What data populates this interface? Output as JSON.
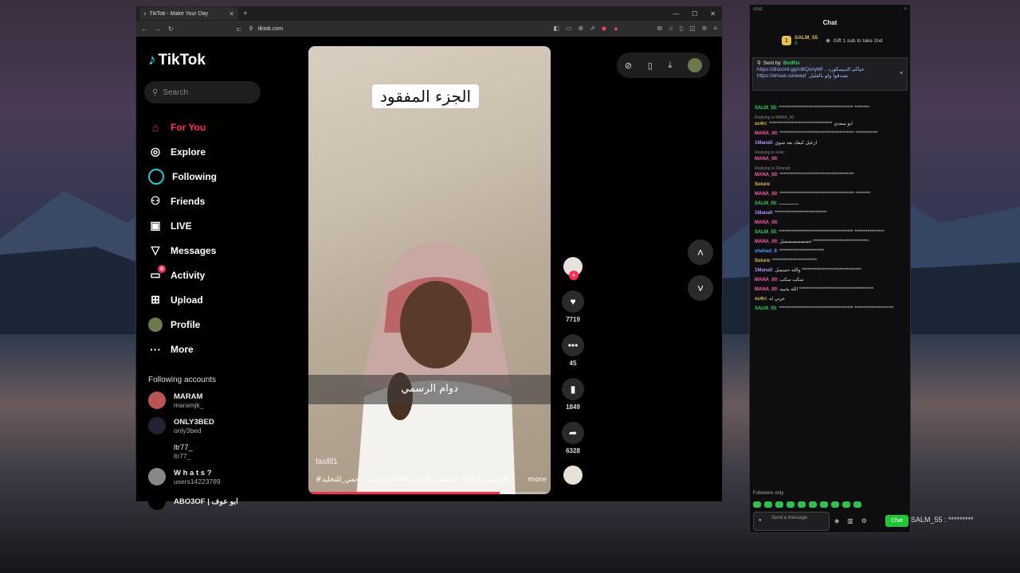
{
  "colors": {
    "tiktok_red": "#fe2c55",
    "chat_green": "#1fc734",
    "bg_dark": "#000000"
  },
  "browser": {
    "tab_title": "TikTok - Make Your Day",
    "url": "tiktok.com"
  },
  "tiktok": {
    "logo": "TikTok",
    "search_placeholder": "Search",
    "nav": [
      {
        "label": "For You",
        "icon": "home-icon"
      },
      {
        "label": "Explore",
        "icon": "compass-icon"
      },
      {
        "label": "Following",
        "icon": "following-icon"
      },
      {
        "label": "Friends",
        "icon": "friends-icon"
      },
      {
        "label": "LIVE",
        "icon": "live-icon"
      },
      {
        "label": "Messages",
        "icon": "messages-icon"
      },
      {
        "label": "Activity",
        "icon": "activity-icon",
        "badge": "8"
      },
      {
        "label": "Upload",
        "icon": "upload-icon"
      },
      {
        "label": "Profile",
        "icon": "profile-icon"
      },
      {
        "label": "More",
        "icon": "more-icon"
      }
    ],
    "following_title": "Following accounts",
    "accounts": [
      {
        "name": "MARAM",
        "handle": "maramjk_"
      },
      {
        "name": "ONLY3BED",
        "handle": "only3bed"
      },
      {
        "name": "ltr77_",
        "handle": "ltr77_"
      },
      {
        "name": "W h a t s ?",
        "handle": "users14223789"
      },
      {
        "name": "ABO3OF | ابو عوف",
        "handle": ""
      }
    ],
    "video": {
      "overlay_title": "الجزء المفقود",
      "subtitle": "دوام الرسمي",
      "creator": "fasllll1",
      "caption": "#دحمي_كوكو# اسطوره_الرياض#148 ارشيف_دحمي_للتخليد#...",
      "more": "more",
      "progress": 0.79
    },
    "actions": {
      "likes": "7719",
      "comments": "45",
      "saves": "1849",
      "shares": "6328"
    }
  },
  "chat": {
    "window_label": "chat",
    "title": "Chat",
    "gift_user": "SALM_55",
    "gift_count": "3",
    "gift_text": "Gift 1 sub to take 2nd",
    "pinned_sender": "Sent by",
    "pinned_bot": "BotRix",
    "pinned_line1": "https://discord.gg/c8tQsnyMf ...حياكم الديسكورد",
    "pinned_line2": "https://ehsan.sa/waqf :تصدقوا ولو بالقليل",
    "messages": [
      {
        "user": "SALM_55",
        "color": "#2fd35b",
        "text": "**************************************** ********"
      },
      {
        "reply": "Replying to MANA_00:",
        "user": "xc4rr",
        "color": "#e8c14a",
        "text": "********************************** ابو سعدي"
      },
      {
        "user": "MANA_00",
        "color": "#ff5ca8",
        "text": "**************************************** ************"
      },
      {
        "user": "1Manall",
        "color": "#b18cff",
        "text": "ازعيل كيفك بعد شوي"
      },
      {
        "reply": "Replying to xc4rr:",
        "user": "MANA_00",
        "color": "#ff5ca8",
        "text": ""
      },
      {
        "reply": "Replying to 1Manall:",
        "user": "MANA_00",
        "color": "#ff5ca8",
        "text": "****************************************"
      },
      {
        "user": "Soiure",
        "color": "#e8c14a",
        "text": ""
      },
      {
        "user": "MANA_00",
        "color": "#ff5ca8",
        "text": "**************************************** ********"
      },
      {
        "user": "SALM_55",
        "color": "#2fd35b",
        "text": "ــــــــــــــ"
      },
      {
        "user": "1Manall",
        "color": "#b18cff",
        "text": "****************************"
      },
      {
        "user": "MANA_00",
        "color": "#ff5ca8",
        "text": ""
      },
      {
        "user": "SALM_55",
        "color": "#2fd35b",
        "text": "**************************************** ****************"
      },
      {
        "user": "MANA_00",
        "color": "#ff5ca8",
        "text": "حسسسسسسل ******************************"
      },
      {
        "user": "shahad_9",
        "color": "#4a9bff",
        "text": "************************"
      },
      {
        "user": "Soiure",
        "color": "#e8c14a",
        "text": "************************"
      },
      {
        "user": "1Manall",
        "color": "#b18cff",
        "text": "والله حسسل ********************************"
      },
      {
        "user": "MANA_00",
        "color": "#ff5ca8",
        "text": "سكب سكب"
      },
      {
        "user": "MANA_00",
        "color": "#ff5ca8",
        "text": "الله يحييه ****************************************"
      },
      {
        "user": "xc4rr",
        "color": "#e8c14a",
        "text": "عزتي له"
      },
      {
        "user": "SALM_55",
        "color": "#2fd35b",
        "text": "**************************************** *********************"
      }
    ],
    "followers_only": "Followers only",
    "input_placeholder": "Send a message",
    "chat_button": "Chat",
    "overlay_text": "SALM_55 : *********"
  }
}
